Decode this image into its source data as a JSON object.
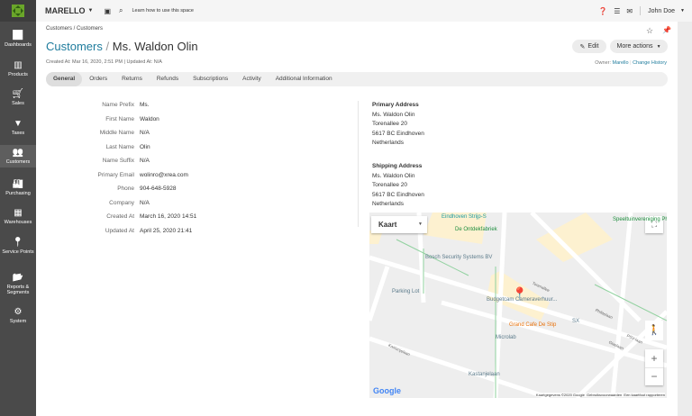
{
  "topbar": {
    "brand": "MARELLO",
    "help_link": "Learn how to use this space",
    "user": "John Doe"
  },
  "sidebar": {
    "items": [
      {
        "label": "Dashboards",
        "icon": "bar-chart-icon"
      },
      {
        "label": "Products",
        "icon": "barcode-icon"
      },
      {
        "label": "Sales",
        "icon": "cart-icon"
      },
      {
        "label": "Taxes",
        "icon": "filter-icon"
      },
      {
        "label": "Customers",
        "icon": "users-icon"
      },
      {
        "label": "Purchasing",
        "icon": "factory-icon"
      },
      {
        "label": "Warehouses",
        "icon": "building-icon"
      },
      {
        "label": "Service Points",
        "icon": "map-marker-icon"
      },
      {
        "label": "Reports & Segments",
        "icon": "folder-icon"
      },
      {
        "label": "System",
        "icon": "gear-icon"
      }
    ]
  },
  "page": {
    "breadcrumb": "Customers / Customers",
    "title_link": "Customers",
    "title_sep": "/",
    "title": "Ms. Waldon Olin",
    "meta": "Created At: Mar 16, 2020, 2:51 PM  |  Updated At: N/A",
    "edit_label": "Edit",
    "more_actions_label": "More actions",
    "owner_label": "Owner:",
    "owner": "Marello",
    "change_history": "Change History"
  },
  "tabs": [
    "General",
    "Orders",
    "Returns",
    "Refunds",
    "Subscriptions",
    "Activity",
    "Additional Information"
  ],
  "fields": [
    {
      "label": "Name Prefix",
      "value": "Ms."
    },
    {
      "label": "First Name",
      "value": "Waldon"
    },
    {
      "label": "Middle Name",
      "value": "N/A"
    },
    {
      "label": "Last Name",
      "value": "Olin"
    },
    {
      "label": "Name Suffix",
      "value": "N/A"
    },
    {
      "label": "Primary Email",
      "value": "wolinro@xrea.com"
    },
    {
      "label": "Phone",
      "value": "904-648-5928"
    },
    {
      "label": "Company",
      "value": "N/A"
    },
    {
      "label": "Created At",
      "value": "March 16, 2020 14:51"
    },
    {
      "label": "Updated At",
      "value": "April 25, 2020 21:41"
    }
  ],
  "primary_address": {
    "title": "Primary Address",
    "lines": [
      "Ms. Waldon Olin",
      "Torenallee 20",
      "5617 BC Eindhoven",
      "Netherlands"
    ]
  },
  "shipping_address": {
    "title": "Shipping Address",
    "lines": [
      "Ms. Waldon Olin",
      "Torenallee 20",
      "5617 BC Eindhoven",
      "Netherlands"
    ]
  },
  "map": {
    "type_select": "Kaart",
    "labels": [
      "Eindhoven Strijp-S",
      "De Ontdekfabriek",
      "Bosch Security Systems BV",
      "Parking Lot",
      "Budgetcam Cameraverhuur...",
      "Grand Cafe De Stip",
      "SX",
      "Microlab",
      "Kastanjelaan",
      "Kastanjelaan",
      "Torenallee",
      "Philitelaan",
      "Glaslaan",
      "PSV-laan",
      "Speeltuinvereniging Philips"
    ],
    "attribution": "Kaartgegevens ©2020 Google",
    "terms": "Gebruiksvoorwaarden",
    "report": "Een kaartfout rapporteren",
    "google": "Google"
  }
}
